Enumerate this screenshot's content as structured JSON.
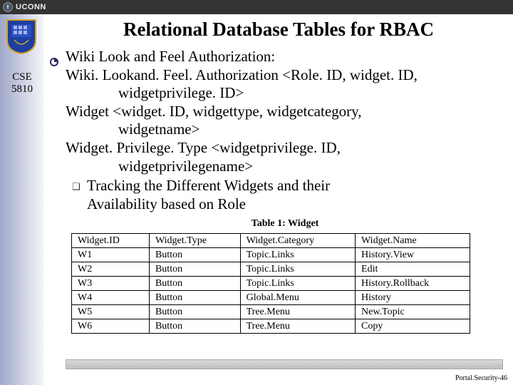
{
  "brand": {
    "name": "UCONN"
  },
  "course": {
    "dept": "CSE",
    "num": "5810"
  },
  "title": "Relational Database Tables for RBAC",
  "body": {
    "heading": "Wiki Look and Feel Authorization:",
    "l1": "Wiki. Lookand. Feel. Authorization <Role. ID, widget. ID,",
    "l1b": "widgetprivilege. ID>",
    "l2": "Widget <widget. ID, widgettype, widgetcategory,",
    "l2b": "widgetname>",
    "l3": "Widget. Privilege. Type <widgetprivilege. ID,",
    "l3b": "widgetprivilegename>",
    "sub1": "Tracking the Different Widgets and their",
    "sub2": "Availability based on Role"
  },
  "table": {
    "caption": "Table 1: Widget",
    "headers": [
      "Widget.ID",
      "Widget.Type",
      "Widget.Category",
      "Widget.Name"
    ],
    "rows": [
      [
        "W1",
        "Button",
        "Topic.Links",
        "History.View"
      ],
      [
        "W2",
        "Button",
        "Topic.Links",
        "Edit"
      ],
      [
        "W3",
        "Button",
        "Topic.Links",
        "History.Rollback"
      ],
      [
        "W4",
        "Button",
        "Global.Menu",
        "History"
      ],
      [
        "W5",
        "Button",
        "Tree.Menu",
        "New.Topic"
      ],
      [
        "W6",
        "Button",
        "Tree.Menu",
        "Copy"
      ]
    ]
  },
  "footer": "Portal.Security-46"
}
